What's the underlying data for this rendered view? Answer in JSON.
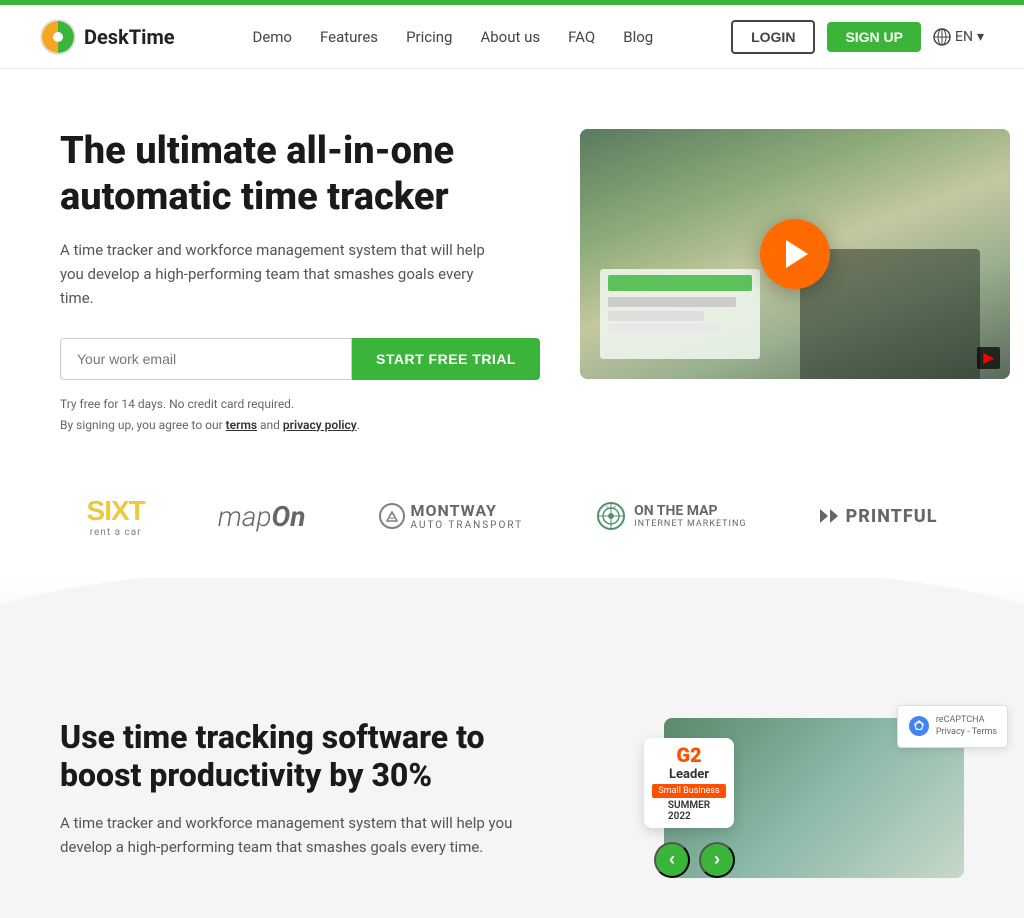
{
  "topBar": {
    "color": "#3ab53a"
  },
  "navbar": {
    "logo": {
      "text": "DeskTime"
    },
    "links": [
      {
        "label": "Demo",
        "id": "demo"
      },
      {
        "label": "Features",
        "id": "features"
      },
      {
        "label": "Pricing",
        "id": "pricing"
      },
      {
        "label": "About us",
        "id": "about"
      },
      {
        "label": "FAQ",
        "id": "faq"
      },
      {
        "label": "Blog",
        "id": "blog"
      }
    ],
    "loginBtn": "LOGIN",
    "signupBtn": "SIGN UP",
    "lang": "EN"
  },
  "hero": {
    "title": "The ultimate all-in-one automatic time tracker",
    "subtitle": "A time tracker and workforce management system that will help you develop a high-performing team that smashes goals every time.",
    "emailPlaceholder": "Your work email",
    "ctaButton": "START FREE TRIAL",
    "finePrint1": "Try free for 14 days. No credit card required.",
    "finePrint2": "By signing up, you agree to our ",
    "termsLink": "terms",
    "finePrint3": " and ",
    "privacyLink": "privacy policy",
    "finePrint4": "."
  },
  "logos": [
    {
      "id": "sixt",
      "text": "SIXT",
      "subtext": "rent a car"
    },
    {
      "id": "mapon",
      "text": "mapOn"
    },
    {
      "id": "montway",
      "text": "MONTWAY",
      "subtext": "AUTO TRANSPORT"
    },
    {
      "id": "onthemap",
      "text": "ON THE MAP",
      "subtext": "INTERNET MARKETING"
    },
    {
      "id": "printful",
      "text": "PRINTFUL"
    }
  ],
  "bottom": {
    "title": "Use time tracking software to boost productivity by 30%",
    "subtitle": "A time tracker and workforce management system that will help you develop a high-performing team that smashes goals every time.",
    "badge": {
      "logo": "G2",
      "label": "Leader",
      "category": "Small Business",
      "season": "SUMMER",
      "year": "2022"
    },
    "carouselPrev": "‹",
    "carouselNext": "›"
  },
  "recaptcha": {
    "line1": "reCAPTCHA",
    "line2": "Privacy - Terms"
  }
}
